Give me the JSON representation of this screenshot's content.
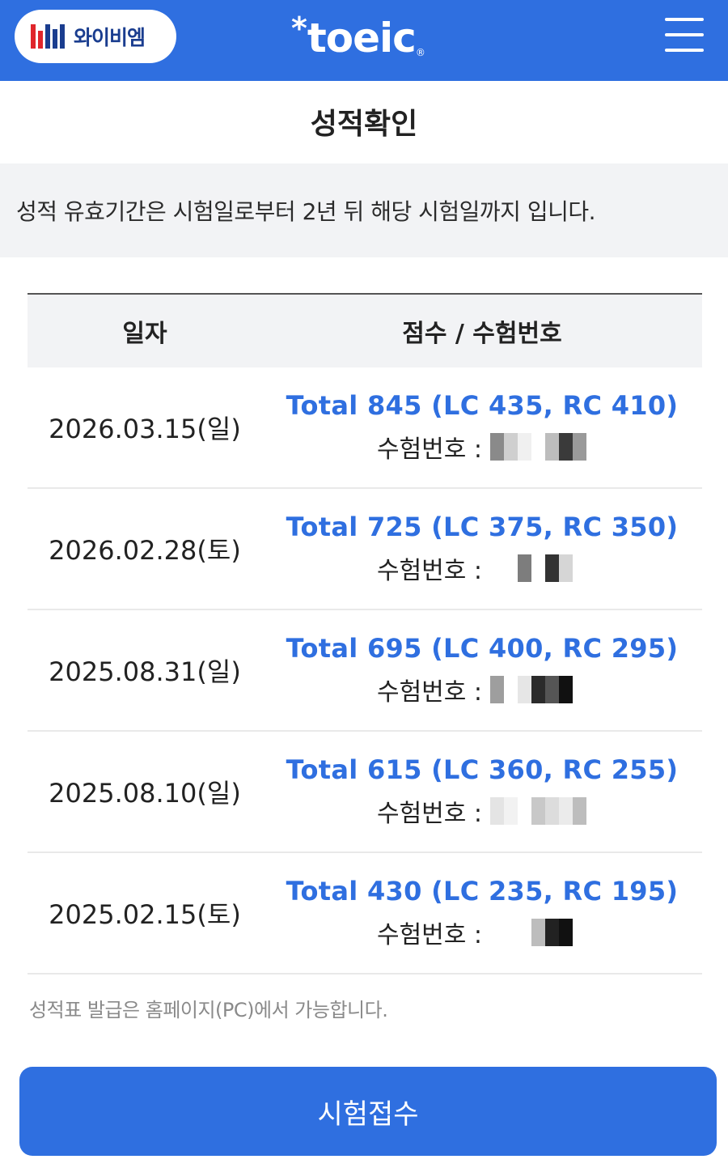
{
  "header": {
    "brand_text": "와이비엠",
    "logo_word": "toeic",
    "logo_reg": "®",
    "menu_icon": "hamburger-menu-icon"
  },
  "page": {
    "title": "성적확인",
    "notice": "성적 유효기간은 시험일로부터 2년 뒤 해당 시험일까지 입니다."
  },
  "table": {
    "headers": {
      "date": "일자",
      "score": "점수 / 수험번호"
    },
    "rows": [
      {
        "date": "2026.03.15(일)",
        "total": "Total 845 (LC 435, RC 410)",
        "regno_label": "수험번호 :"
      },
      {
        "date": "2026.02.28(토)",
        "total": "Total 725 (LC 375, RC 350)",
        "regno_label": "수험번호 :"
      },
      {
        "date": "2025.08.31(일)",
        "total": "Total 695 (LC 400, RC 295)",
        "regno_label": "수험번호 :"
      },
      {
        "date": "2025.08.10(일)",
        "total": "Total 615 (LC 360, RC 255)",
        "regno_label": "수험번호 :"
      },
      {
        "date": "2025.02.15(토)",
        "total": "Total 430 (LC 235, RC 195)",
        "regno_label": "수험번호 :"
      }
    ]
  },
  "footer": {
    "note": "성적표 발급은 홈페이지(PC)에서 가능합니다.",
    "apply_button": "시험접수"
  },
  "colors": {
    "brand_blue": "#2f6fe0",
    "header_bg": "#2f6fe0",
    "notice_bg": "#f2f3f5"
  }
}
